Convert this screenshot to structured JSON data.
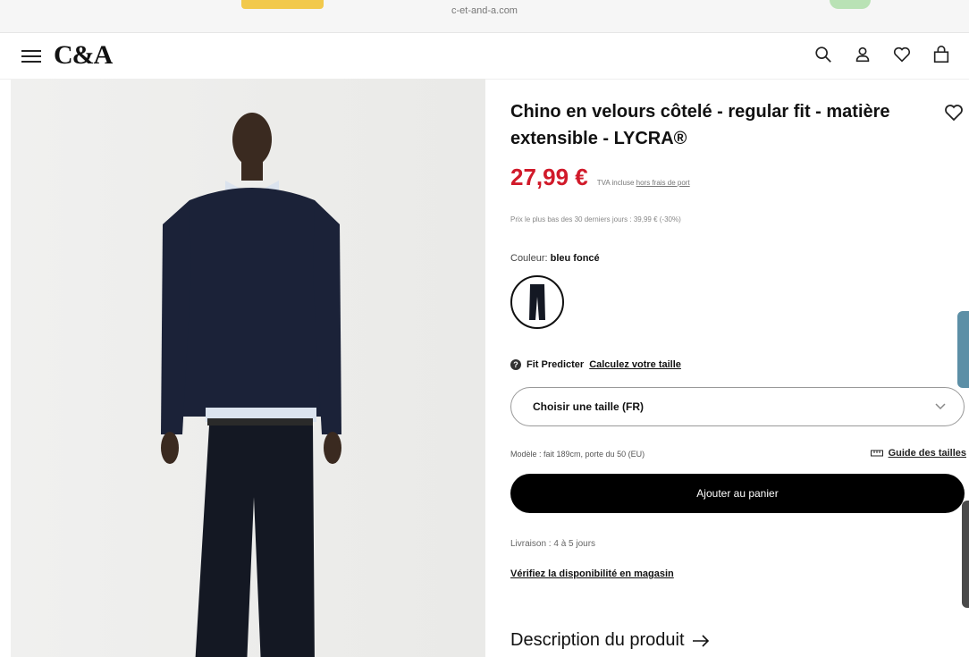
{
  "browser": {
    "url": "c-et-and-a.com"
  },
  "header": {
    "logo": "C&A"
  },
  "product": {
    "title": "Chino en velours côtelé - regular fit - matière extensible - LYCRA®",
    "price": "27,99 €",
    "tva_note": "TVA incluse",
    "shipping_link": "hors frais de port",
    "lowest_price_note": "Prix le plus bas des 30 derniers jours : 39,99 € (-30%)",
    "color_label": "Couleur:",
    "color_value": "bleu foncé",
    "fit_label": "Fit Predicter",
    "fit_link": "Calculez votre taille",
    "size_placeholder": "Choisir une taille (FR)",
    "model_info": "Modèle : fait 189cm, porte du 50 (EU)",
    "size_guide": "Guide des tailles",
    "add_to_cart": "Ajouter au panier",
    "delivery": "Livraison : 4 à 5 jours",
    "store_check": "Vérifiez la disponibilité en magasin",
    "description_heading": "Description du produit"
  },
  "colors": {
    "price": "#d11a2a",
    "button": "#000000",
    "accent_tab": "#5c8fa6"
  },
  "icons": {
    "menu": "hamburger-icon",
    "search": "search-icon",
    "account": "user-icon",
    "wishlist": "heart-icon",
    "bag": "bag-icon"
  }
}
